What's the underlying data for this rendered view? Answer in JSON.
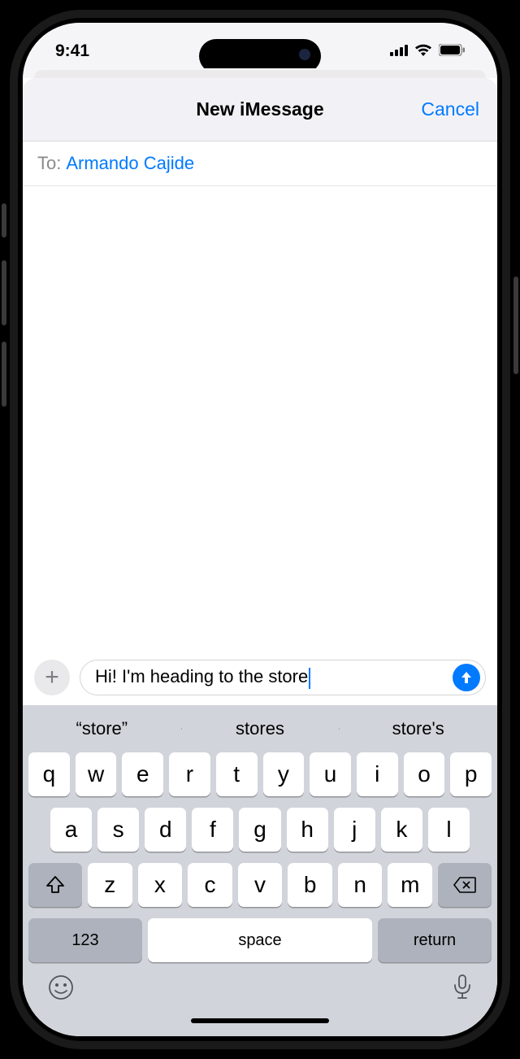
{
  "status": {
    "time": "9:41"
  },
  "header": {
    "title": "New iMessage",
    "cancel": "Cancel"
  },
  "to": {
    "label": "To:",
    "name": "Armando Cajide"
  },
  "compose": {
    "text": "Hi! I'm heading to the store"
  },
  "suggestions": [
    "“store”",
    "stores",
    "store's"
  ],
  "keys": {
    "row1": [
      "q",
      "w",
      "e",
      "r",
      "t",
      "y",
      "u",
      "i",
      "o",
      "p"
    ],
    "row2": [
      "a",
      "s",
      "d",
      "f",
      "g",
      "h",
      "j",
      "k",
      "l"
    ],
    "row3": [
      "z",
      "x",
      "c",
      "v",
      "b",
      "n",
      "m"
    ],
    "num": "123",
    "space": "space",
    "ret": "return"
  }
}
